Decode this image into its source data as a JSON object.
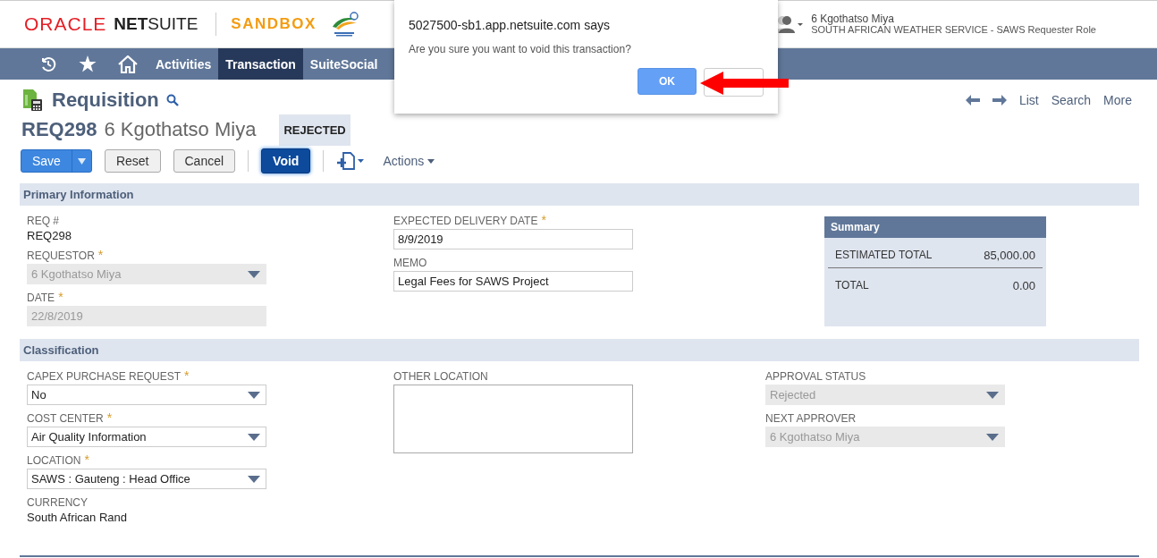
{
  "header": {
    "brand": "ORACLE",
    "product": "**NET**SUITE",
    "env": "SANDBOX",
    "user_name": "6 Kgothatso Miya",
    "user_role": "SOUTH AFRICAN WEATHER SERVICE - SAWS Requester Role"
  },
  "nav": [
    {
      "kind": "recent",
      "selected": false
    },
    {
      "kind": "star",
      "selected": false
    },
    {
      "kind": "home",
      "selected": false
    },
    {
      "kind": "text",
      "label": "Activities",
      "selected": false
    },
    {
      "kind": "text",
      "label": "Transaction",
      "selected": true
    },
    {
      "kind": "text",
      "label": "SuiteSocial",
      "selected": false
    }
  ],
  "page": {
    "title": "Requisition",
    "nav_links": [
      "List",
      "Search",
      "More"
    ],
    "record_number": "REQ298",
    "record_name": "6 Kgothatso Miya",
    "status": "REJECTED"
  },
  "buttons": [
    {
      "kind": "split",
      "label": "Save"
    },
    {
      "kind": "plain",
      "label": "Reset"
    },
    {
      "kind": "plain",
      "label": "Cancel"
    },
    {
      "kind": "focused",
      "label": "Void"
    }
  ],
  "actions": "Actions",
  "sections": [
    {
      "title": "Primary Information",
      "columns": [
        [
          {
            "kind": "text",
            "label": "REQ #",
            "value": "REQ298"
          },
          {
            "kind": "select",
            "label": "REQUESTOR",
            "required_mark": "*",
            "value": "6 Kgothatso Miya",
            "disabled": true
          },
          {
            "kind": "input",
            "label": "DATE",
            "required_mark": "*",
            "value": "22/8/2019",
            "disabled": true
          }
        ],
        [
          {
            "kind": "input",
            "label": "EXPECTED DELIVERY DATE",
            "required_mark": "*",
            "value": "8/9/2019",
            "disabled": false
          },
          {
            "kind": "input",
            "label": "MEMO",
            "value": "Legal Fees for SAWS Project",
            "disabled": false
          }
        ]
      ],
      "summary": {
        "title": "Summary",
        "rows": [
          {
            "label": "ESTIMATED TOTAL",
            "value": "85,000.00"
          },
          {
            "label": "TOTAL",
            "value": "0.00"
          }
        ]
      }
    },
    {
      "title": "Classification",
      "columns": [
        [
          {
            "kind": "select",
            "label": "CAPEX PURCHASE REQUEST",
            "required_mark": "*",
            "value": "No",
            "disabled": false
          },
          {
            "kind": "select",
            "label": "COST CENTER",
            "required_mark": "*",
            "value": "Air Quality Information",
            "disabled": false
          },
          {
            "kind": "select",
            "label": "LOCATION",
            "required_mark": "*",
            "value": "SAWS : Gauteng : Head Office",
            "disabled": false
          },
          {
            "kind": "text",
            "label": "CURRENCY",
            "value": "South African Rand"
          }
        ],
        [
          {
            "kind": "textarea",
            "label": "OTHER LOCATION",
            "disabled": false
          }
        ],
        [
          {
            "kind": "select",
            "label": "APPROVAL STATUS",
            "value": "Rejected",
            "disabled": true
          },
          {
            "kind": "select",
            "label": "NEXT APPROVER",
            "value": "6 Kgothatso Miya",
            "disabled": true
          }
        ]
      ]
    }
  ],
  "dialog": {
    "origin": "5027500-sb1.app.netsuite.com says",
    "message": "Are you sure you want to void this transaction?",
    "ok": "OK"
  }
}
